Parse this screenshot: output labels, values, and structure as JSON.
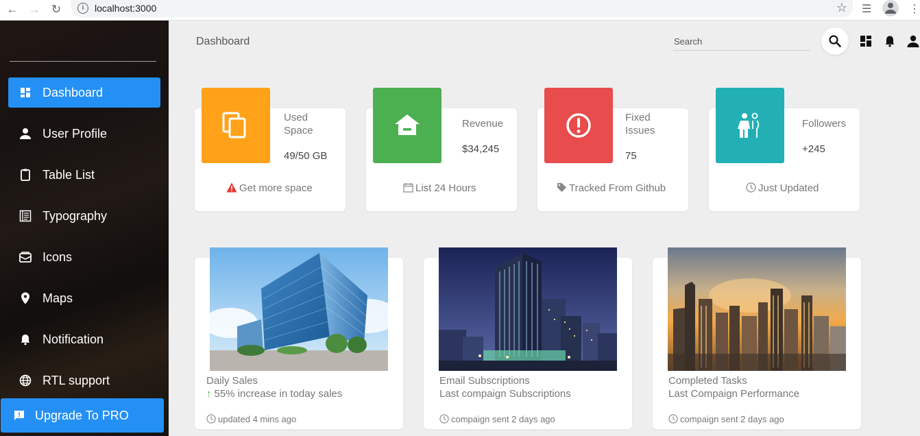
{
  "browser": {
    "url": "localhost:3000",
    "back_icon": "arrow-left-icon",
    "forward_icon": "arrow-right-icon",
    "reload_icon": "reload-icon"
  },
  "sidebar": {
    "items": [
      {
        "label": "Dashboard",
        "icon": "dashboard-icon",
        "active": true
      },
      {
        "label": "User Profile",
        "icon": "person-icon"
      },
      {
        "label": "Table List",
        "icon": "clipboard-icon"
      },
      {
        "label": "Typography",
        "icon": "document-icon"
      },
      {
        "label": "Icons",
        "icon": "bubble-icon"
      },
      {
        "label": "Maps",
        "icon": "location-icon"
      },
      {
        "label": "Notification",
        "icon": "bell-icon"
      },
      {
        "label": "RTL support",
        "icon": "language-icon"
      }
    ],
    "upgrade_label": "Upgrade To PRO",
    "accent": "#2490f5"
  },
  "header": {
    "title": "Dashboard",
    "search_placeholder": "Search"
  },
  "stats": [
    {
      "title": "Used Space",
      "value": "49/50 GB",
      "footer": "Get more space",
      "color": "#ffa21a",
      "icon": "content-copy-icon",
      "footer_icon": "warning-icon"
    },
    {
      "title": "Revenue",
      "value": "$34,245",
      "footer": "List 24 Hours",
      "color": "#4caf50",
      "icon": "store-icon",
      "footer_icon": "calendar-icon"
    },
    {
      "title": "Fixed Issues",
      "value": "75",
      "footer": "Tracked From Github",
      "color": "#e84c4c",
      "icon": "info-outline-icon",
      "footer_icon": "tag-icon"
    },
    {
      "title": "Followers",
      "value": "+245",
      "footer": "Just Updated",
      "color": "#22b0b4",
      "icon": "accessibility-icon",
      "footer_icon": "clock-icon"
    }
  ],
  "cards": [
    {
      "title": "Daily Sales",
      "subtitle": "55% increase in today sales",
      "footer": "updated 4 mins ago",
      "image": "glass office building photo"
    },
    {
      "title": "Email Subscriptions",
      "subtitle": "Last compaign Subscriptions",
      "footer": "compaign sent 2 days ago",
      "image": "skyscraper at night photo"
    },
    {
      "title": "Completed Tasks",
      "subtitle": "Last Compaign Performance",
      "footer": "compaign sent 2 days ago",
      "image": "city skyline at sunset photo"
    }
  ]
}
